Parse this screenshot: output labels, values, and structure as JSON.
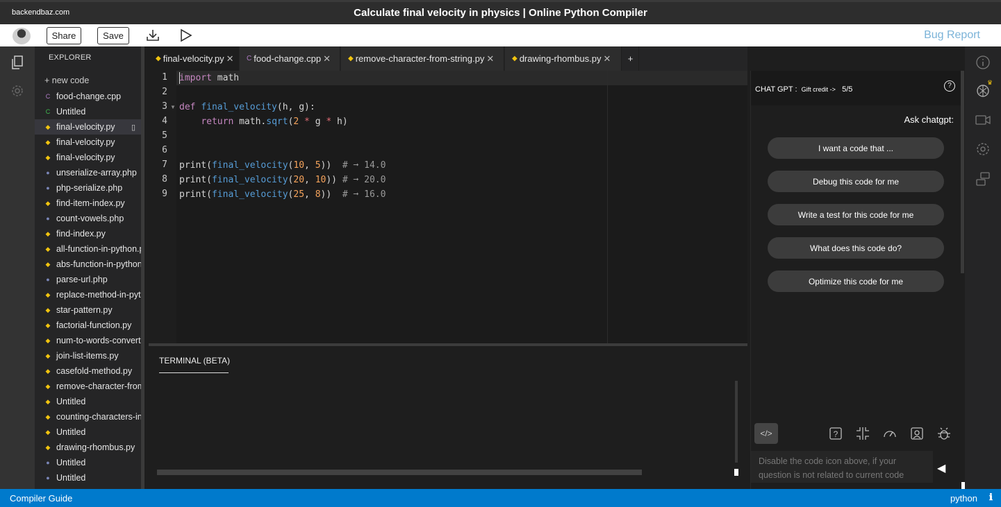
{
  "titlebar": {
    "site": "backendbaz.com",
    "title": "Calculate final velocity in physics | Online Python Compiler"
  },
  "toolbar": {
    "share_label": "Share",
    "save_label": "Save",
    "download_icon": "download-icon",
    "run_icon": "play-icon",
    "bug_report": "Bug Report"
  },
  "explorer": {
    "header": "EXPLORER",
    "new_code": "+ new code",
    "files": [
      {
        "name": "food-change.cpp",
        "icon": "cpp"
      },
      {
        "name": "Untitled",
        "icon": "c"
      },
      {
        "name": "final-velocity.py",
        "icon": "py"
      },
      {
        "name": "final-velocity.py",
        "icon": "py"
      },
      {
        "name": "final-velocity.py",
        "icon": "py"
      },
      {
        "name": "unserialize-array.php",
        "icon": "php"
      },
      {
        "name": "php-serialize.php",
        "icon": "php"
      },
      {
        "name": "find-item-index.py",
        "icon": "py"
      },
      {
        "name": "count-vowels.php",
        "icon": "php"
      },
      {
        "name": "find-index.py",
        "icon": "py"
      },
      {
        "name": "all-function-in-python.py",
        "icon": "py"
      },
      {
        "name": "abs-function-in-python.py",
        "icon": "py"
      },
      {
        "name": "parse-url.php",
        "icon": "php"
      },
      {
        "name": "replace-method-in-python.py",
        "icon": "py"
      },
      {
        "name": "star-pattern.py",
        "icon": "py"
      },
      {
        "name": "factorial-function.py",
        "icon": "py"
      },
      {
        "name": "num-to-words-converter.py",
        "icon": "py"
      },
      {
        "name": "join-list-items.py",
        "icon": "py"
      },
      {
        "name": "casefold-method.py",
        "icon": "py"
      },
      {
        "name": "remove-character-from-string.py",
        "icon": "py"
      },
      {
        "name": "Untitled",
        "icon": "py"
      },
      {
        "name": "counting-characters-in-string.py",
        "icon": "py"
      },
      {
        "name": "Untitled",
        "icon": "py"
      },
      {
        "name": "drawing-rhombus.py",
        "icon": "py"
      },
      {
        "name": "Untitled",
        "icon": "php"
      },
      {
        "name": "Untitled",
        "icon": "php"
      }
    ]
  },
  "tabs": [
    {
      "label": "final-velocity.py",
      "icon": "py"
    },
    {
      "label": "food-change.cpp",
      "icon": "cpp"
    },
    {
      "label": "remove-character-from-string.py",
      "icon": "py"
    },
    {
      "label": "drawing-rhombus.py",
      "icon": "py"
    }
  ],
  "tab_add": "+",
  "editor": {
    "line_numbers": [
      "1",
      "2",
      "3",
      "4",
      "5",
      "6",
      "7",
      "8",
      "9"
    ],
    "lines": [
      "import math",
      "",
      "def final_velocity(h, g):",
      "    return math.sqrt(2 * g * h)",
      "",
      "",
      "print(final_velocity(10, 5))  # ➞ 14.0",
      "print(final_velocity(20, 10)) # ➞ 20.0",
      "print(final_velocity(25, 8))  # ➞ 16.0"
    ]
  },
  "terminal": {
    "title": "TERMINAL (BETA)"
  },
  "chat": {
    "label": "CHAT GPT :",
    "credit_label": "Gift credit ->",
    "credit_value": "5/5",
    "ask": "Ask chatgpt:",
    "suggestions": [
      "I want a code that ...",
      "Debug this code for me",
      "Write a test for this code for me",
      "What does this code do?",
      "Optimize this code for me"
    ],
    "input_placeholder": "Disable the code icon above, if your question is not related to current code"
  },
  "statusbar": {
    "left": "Compiler Guide",
    "language": "python",
    "info_glyph": "ℹ"
  },
  "colors": {
    "status": "#007acc",
    "editor_bg": "#1e1e1e",
    "accent_link": "#7bb3d8"
  }
}
